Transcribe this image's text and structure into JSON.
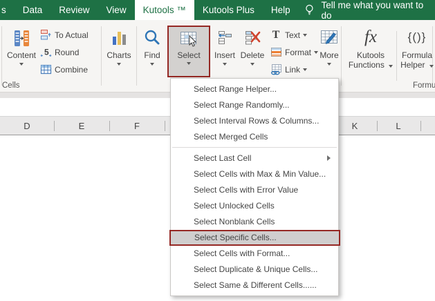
{
  "colors": {
    "excel_green": "#1E7145",
    "highlight_red": "#952824",
    "highlight_fill": "#D0CECE"
  },
  "tab_bar": {
    "partial_tab_label": "s",
    "tabs": [
      {
        "label": "Data",
        "active": false
      },
      {
        "label": "Review",
        "active": false
      },
      {
        "label": "View",
        "active": false
      },
      {
        "label": "Kutools ™",
        "active": true
      },
      {
        "label": "Kutools Plus",
        "active": false
      },
      {
        "label": "Help",
        "active": false
      }
    ],
    "tell_me_label": "Tell me what you want to do"
  },
  "ribbon": {
    "content_button": "Content",
    "small_buttons": [
      "To Actual",
      "Round",
      "Combine"
    ],
    "charts_button": "Charts",
    "find_button": "Find",
    "select_button": "Select",
    "insert_button": "Insert",
    "delete_button": "Delete",
    "text_button": "Text",
    "format_button": "Format",
    "link_button": "Link",
    "more_button": "More",
    "kutools_functions_line1": "Kutools",
    "kutools_functions_line2": "Functions",
    "formula_helper_line1": "Formula",
    "formula_helper_line2": "Helper",
    "group_labels": {
      "cells": "Cells",
      "formula_partial": "Formu"
    }
  },
  "column_headers": {
    "left": [
      "D",
      "E",
      "F"
    ],
    "right": [
      "K",
      "L"
    ]
  },
  "menu": {
    "items": [
      {
        "label": "Select Range Helper...",
        "submenu": false,
        "highlighted": false
      },
      {
        "label": "Select Range Randomly...",
        "submenu": false,
        "highlighted": false
      },
      {
        "label": "Select Interval Rows & Columns...",
        "submenu": false,
        "highlighted": false
      },
      {
        "label": "Select Merged Cells",
        "submenu": false,
        "highlighted": false
      },
      {
        "type": "separator"
      },
      {
        "label": "Select Last Cell",
        "submenu": true,
        "highlighted": false
      },
      {
        "label": "Select Cells with Max & Min Value...",
        "submenu": false,
        "highlighted": false
      },
      {
        "label": "Select Cells with Error Value",
        "submenu": false,
        "highlighted": false
      },
      {
        "label": "Select Unlocked Cells",
        "submenu": false,
        "highlighted": false
      },
      {
        "label": "Select Nonblank Cells",
        "submenu": false,
        "highlighted": false
      },
      {
        "label": "Select Specific Cells...",
        "submenu": false,
        "highlighted": true
      },
      {
        "label": "Select Cells with Format...",
        "submenu": false,
        "highlighted": false
      },
      {
        "label": "Select Duplicate & Unique Cells...",
        "submenu": false,
        "highlighted": false
      },
      {
        "label": "Select Same & Different Cells......",
        "submenu": false,
        "highlighted": false
      }
    ]
  }
}
